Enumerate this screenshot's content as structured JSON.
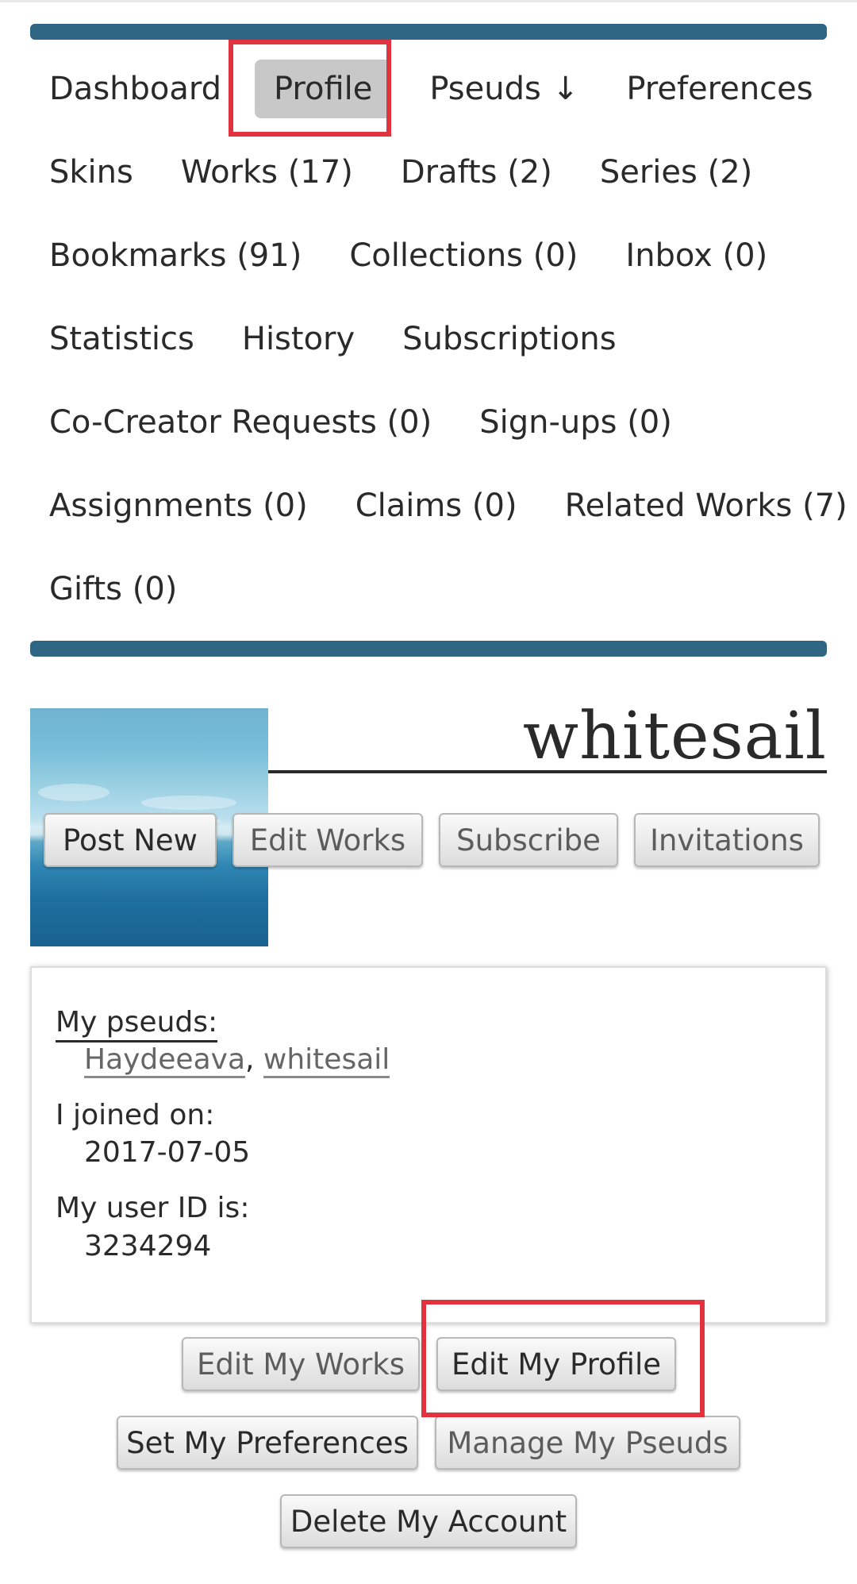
{
  "nav": {
    "rows": [
      [
        {
          "label": "Dashboard",
          "current": false
        },
        {
          "label": "Profile",
          "current": true
        },
        {
          "label": "Pseuds",
          "arrow": "↓"
        },
        {
          "label": "Preferences"
        }
      ],
      [
        {
          "label": "Skins"
        },
        {
          "label": "Works (17)"
        },
        {
          "label": "Drafts (2)"
        },
        {
          "label": "Series (2)"
        }
      ],
      [
        {
          "label": "Bookmarks (91)"
        },
        {
          "label": "Collections (0)"
        },
        {
          "label": "Inbox (0)"
        }
      ],
      [
        {
          "label": "Statistics"
        },
        {
          "label": "History"
        },
        {
          "label": "Subscriptions"
        }
      ],
      [
        {
          "label": "Co-Creator Requests (0)"
        },
        {
          "label": "Sign-ups (0)"
        }
      ],
      [
        {
          "label": "Assignments (0)"
        },
        {
          "label": "Claims (0)"
        },
        {
          "label": "Related Works (7)"
        }
      ],
      [
        {
          "label": "Gifts (0)"
        }
      ]
    ],
    "accent_color": "#2f6684"
  },
  "profile": {
    "username": "whitesail",
    "icon": "sea-horizon-icon",
    "actions": {
      "post_new": "Post New",
      "edit_works": "Edit Works",
      "subscribe": "Subscribe",
      "invitations": "Invitations"
    }
  },
  "meta": {
    "pseuds_label": "My pseuds:",
    "pseuds": [
      "Haydeeava",
      "whitesail"
    ],
    "pseud_separator": ",",
    "joined_label": "I joined on:",
    "joined_value": "2017-07-05",
    "user_id_label": "My user ID is:",
    "user_id_value": "3234294"
  },
  "account_actions": {
    "edit_my_works": "Edit My Works",
    "edit_my_profile": "Edit My Profile",
    "set_my_preferences": "Set My Preferences",
    "manage_my_pseuds": "Manage My Pseuds",
    "delete_my_account": "Delete My Account"
  },
  "highlight_color": "#e0333f"
}
